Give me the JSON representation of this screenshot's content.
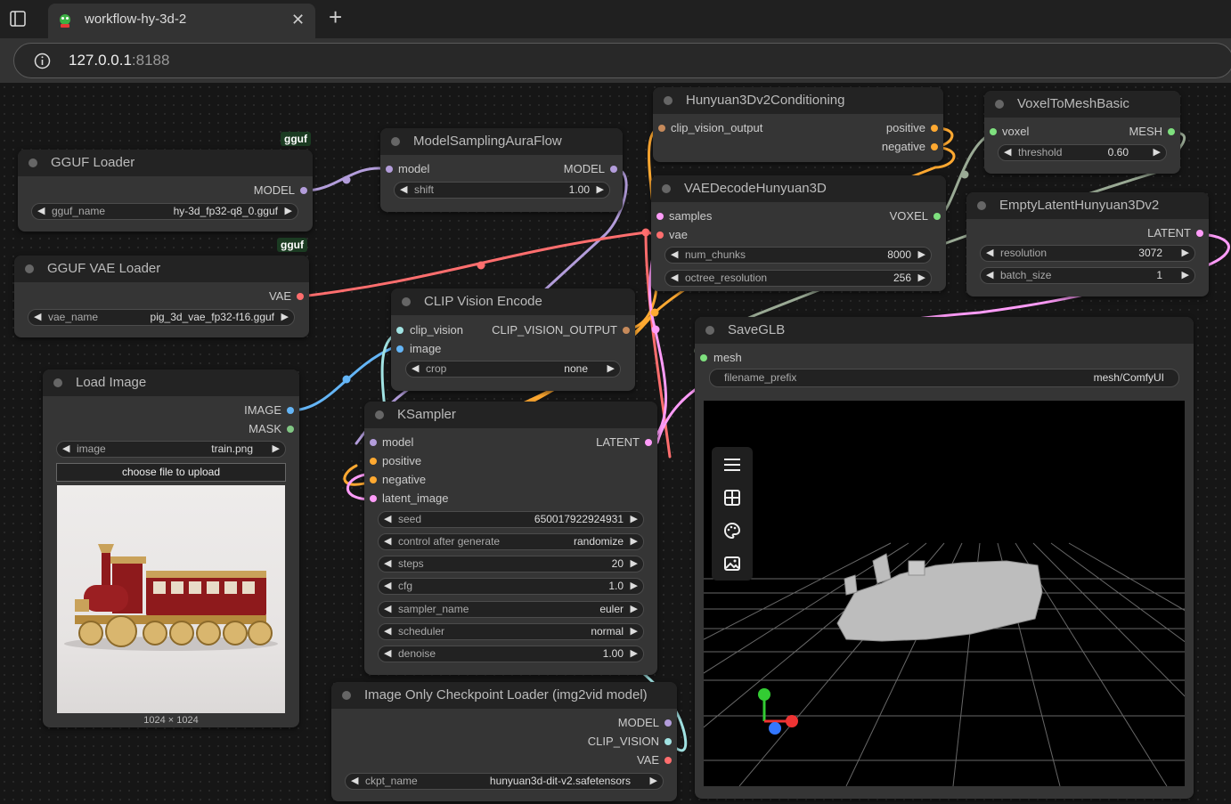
{
  "browser": {
    "tab_title": "workflow-hy-3d-2",
    "url_host": "127.0.0.1",
    "url_port": ":8188"
  },
  "badges": {
    "gguf_1": "gguf",
    "gguf_2": "gguf"
  },
  "nodes": {
    "gguf_loader": {
      "title": "GGUF Loader",
      "out_model": "MODEL",
      "w_label": "gguf_name",
      "w_value": "hy-3d_fp32-q8_0.gguf"
    },
    "gguf_vae_loader": {
      "title": "GGUF VAE Loader",
      "out_vae": "VAE",
      "w_label": "vae_name",
      "w_value": "pig_3d_vae_fp32-f16.gguf"
    },
    "model_sampling": {
      "title": "ModelSamplingAuraFlow",
      "in_model": "model",
      "out_model": "MODEL",
      "w_label": "shift",
      "w_value": "1.00"
    },
    "hunyuan_cond": {
      "title": "Hunyuan3Dv2Conditioning",
      "in_clip": "clip_vision_output",
      "out_pos": "positive",
      "out_neg": "negative"
    },
    "voxel_to_mesh": {
      "title": "VoxelToMeshBasic",
      "in_voxel": "voxel",
      "out_mesh": "MESH",
      "w_label": "threshold",
      "w_value": "0.60"
    },
    "vae_decode": {
      "title": "VAEDecodeHunyuan3D",
      "in_samples": "samples",
      "in_vae": "vae",
      "out_voxel": "VOXEL",
      "w1_label": "num_chunks",
      "w1_value": "8000",
      "w2_label": "octree_resolution",
      "w2_value": "256"
    },
    "empty_latent": {
      "title": "EmptyLatentHunyuan3Dv2",
      "out_latent": "LATENT",
      "w1_label": "resolution",
      "w1_value": "3072",
      "w2_label": "batch_size",
      "w2_value": "1"
    },
    "clip_vision_encode": {
      "title": "CLIP Vision Encode",
      "in_clip": "clip_vision",
      "in_image": "image",
      "out": "CLIP_VISION_OUTPUT",
      "w_label": "crop",
      "w_value": "none"
    },
    "load_image": {
      "title": "Load Image",
      "out_image": "IMAGE",
      "out_mask": "MASK",
      "w_label": "image",
      "w_value": "train.png",
      "upload_label": "choose file to upload",
      "size_label": "1024 × 1024"
    },
    "ksampler": {
      "title": "KSampler",
      "in_model": "model",
      "in_pos": "positive",
      "in_neg": "negative",
      "in_latent": "latent_image",
      "out_latent": "LATENT",
      "widgets": [
        {
          "label": "seed",
          "value": "650017922924931"
        },
        {
          "label": "control after generate",
          "value": "randomize"
        },
        {
          "label": "steps",
          "value": "20"
        },
        {
          "label": "cfg",
          "value": "1.0"
        },
        {
          "label": "sampler_name",
          "value": "euler"
        },
        {
          "label": "scheduler",
          "value": "normal"
        },
        {
          "label": "denoise",
          "value": "1.00"
        }
      ]
    },
    "save_glb": {
      "title": "SaveGLB",
      "in_mesh": "mesh",
      "w_label": "filename_prefix",
      "w_value": "mesh/ComfyUI"
    },
    "checkpoint_loader": {
      "title": "Image Only Checkpoint Loader (img2vid model)",
      "out_model": "MODEL",
      "out_clip": "CLIP_VISION",
      "out_vae": "VAE",
      "w_label": "ckpt_name",
      "w_value": "hunyuan3d-dit-v2.safetensors"
    }
  },
  "viewer_toolbar": [
    "menu-icon",
    "grid-icon",
    "palette-icon",
    "image-icon"
  ],
  "colors": {
    "model": "#b39ddb",
    "vae": "#ff6e6e",
    "clip": "#a1e3e3",
    "image": "#64b5f6",
    "conditioning": "#ffa931",
    "latent": "#ff9cf9",
    "mesh": "#7ee07e",
    "voxel": "#7ee07e",
    "mask": "#81c784"
  }
}
